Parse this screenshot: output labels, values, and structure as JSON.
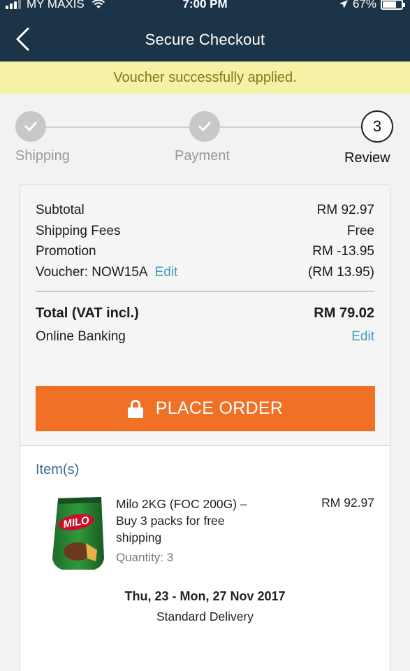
{
  "status_bar": {
    "carrier": "MY MAXIS",
    "time": "7:00 PM",
    "battery": "67%",
    "battery_level": 0.67
  },
  "header": {
    "title": "Secure Checkout",
    "back_icon": "chevron-left-icon"
  },
  "notice": {
    "text": "Voucher successfully applied."
  },
  "stepper": {
    "steps": [
      {
        "label": "Shipping",
        "state": "done"
      },
      {
        "label": "Payment",
        "state": "done"
      },
      {
        "label": "Review",
        "state": "current",
        "number": "3"
      }
    ]
  },
  "summary": {
    "subtotal_label": "Subtotal",
    "subtotal_value": "RM 92.97",
    "shipping_label": "Shipping Fees",
    "shipping_value": "Free",
    "promotion_label": "Promotion",
    "promotion_value": "RM -13.95",
    "voucher_label": "Voucher: NOW15A",
    "voucher_edit": "Edit",
    "voucher_value": "(RM 13.95)",
    "total_label": "Total (VAT incl.)",
    "total_value": "RM 79.02",
    "payment_label": "Online Banking",
    "payment_edit": "Edit"
  },
  "place_order": {
    "label": "PLACE ORDER",
    "color": "#f07126"
  },
  "items": {
    "title": "Item(s)",
    "list": [
      {
        "name": "Milo 2KG (FOC 200G) – Buy 3 packs for free shipping",
        "price": "RM 92.97",
        "quantity": "Quantity: 3",
        "brand_text": "MILO"
      }
    ],
    "delivery_date": "Thu, 23 - Mon, 27 Nov 2017",
    "delivery_type": "Standard Delivery"
  },
  "colors": {
    "header_bg": "#1c3448",
    "notice_bg": "#f7f1a6",
    "notice_text": "#7d7a1c",
    "link": "#3d9fb8",
    "accent": "#f07126"
  }
}
